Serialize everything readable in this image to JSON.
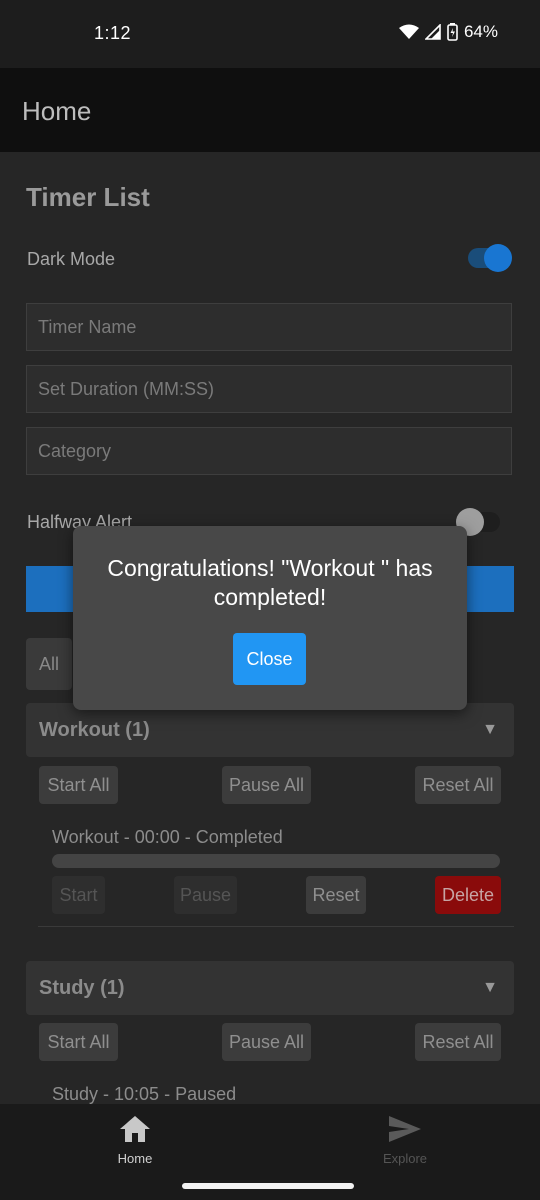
{
  "status_bar": {
    "time": "1:12",
    "battery": "64%"
  },
  "app_bar": {
    "title": "Home"
  },
  "page": {
    "title": "Timer List"
  },
  "settings": {
    "dark_mode_label": "Dark Mode",
    "dark_mode_on": true,
    "halfway_alert_label": "Halfway Alert",
    "halfway_alert_on": false
  },
  "form": {
    "timer_name_placeholder": "Timer Name",
    "duration_placeholder": "Set Duration (MM:SS)",
    "category_placeholder": "Category"
  },
  "filter": {
    "active_label": "All"
  },
  "groups": [
    {
      "title": "Workout (1)",
      "start_all": "Start All",
      "pause_all": "Pause All",
      "reset_all": "Reset All",
      "timers": [
        {
          "line": "Workout  - 00:00 - Completed",
          "progress": 1.0,
          "start": "Start",
          "pause": "Pause",
          "reset": "Reset",
          "delete": "Delete"
        }
      ]
    },
    {
      "title": "Study (1)",
      "start_all": "Start All",
      "pause_all": "Pause All",
      "reset_all": "Reset All",
      "timers": [
        {
          "line": "Study  - 10:05 - Paused"
        }
      ]
    }
  ],
  "dialog": {
    "message": "Congratulations! \"Workout \" has completed!",
    "close_label": "Close"
  },
  "bottom_nav": {
    "home_label": "Home",
    "explore_label": "Explore"
  },
  "colors": {
    "accent": "#2196f3",
    "toggle_on": "#1976d2",
    "danger": "#8a0b0b"
  }
}
